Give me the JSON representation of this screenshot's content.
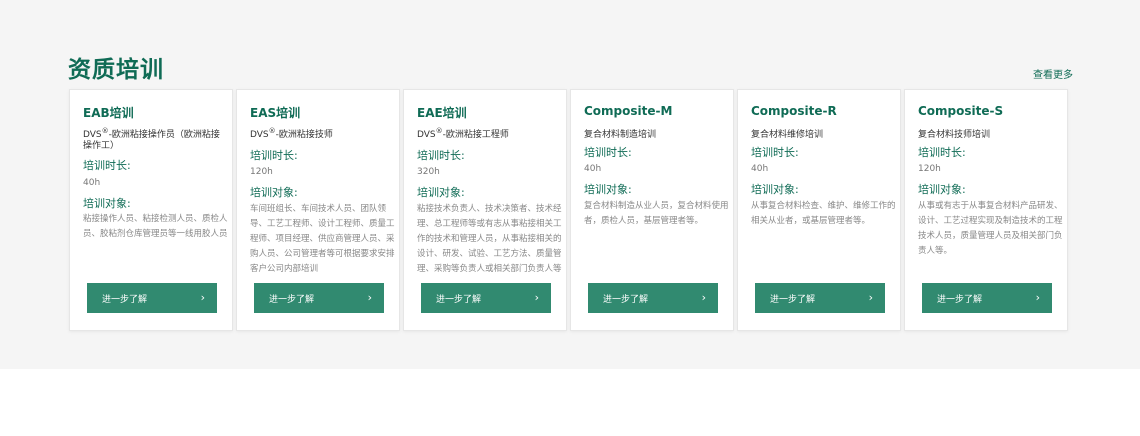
{
  "section": {
    "title": "资质培训",
    "more": "查看更多"
  },
  "labels": {
    "duration": "培训时长:",
    "audience": "培训对象:",
    "button": "进一步了解"
  },
  "cards": [
    {
      "title": "EAB培训",
      "sub_prefix": "DVS",
      "sub_sup": "®",
      "sub_suffix": "-欧洲粘接操作员（欧洲粘接操作工）",
      "hours": "40h",
      "audience": "粘接操作人员、粘接检测人员、质检人员、胶粘剂仓库管理员等一线用胶人员"
    },
    {
      "title": "EAS培训",
      "sub_prefix": "DVS",
      "sub_sup": "®",
      "sub_suffix": "-欧洲粘接技师",
      "hours": "120h",
      "audience": "车间班组长、车间技术人员、团队领导、工艺工程师、设计工程师、质量工程师、项目经理、供应商管理人员、采购人员、公司管理者等可根据要求安排客户公司内部培训"
    },
    {
      "title": "EAE培训",
      "sub_prefix": "DVS",
      "sub_sup": "®",
      "sub_suffix": "-欧洲粘接工程师",
      "hours": "320h",
      "audience": "粘接技术负责人、技术决策者、技术经理、总工程师等或有志从事粘接相关工作的技术和管理人员，从事粘接相关的设计、研发、试验、工艺方法、质量管理、采购等负责人或相关部门负责人等"
    },
    {
      "title": "Composite-M",
      "sub_prefix": "复合材料制造培训",
      "sub_sup": "",
      "sub_suffix": "",
      "hours": "40h",
      "audience": "复合材料制造从业人员，复合材料使用者，质检人员，基层管理者等。"
    },
    {
      "title": "Composite-R",
      "sub_prefix": "复合材料维修培训",
      "sub_sup": "",
      "sub_suffix": "",
      "hours": "40h",
      "audience": "从事复合材料检查、维护、维修工作的相关从业者，或基层管理者等。"
    },
    {
      "title": "Composite-S",
      "sub_prefix": "复合材料技师培训",
      "sub_sup": "",
      "sub_suffix": "",
      "hours": "120h",
      "audience": "从事或有志于从事复合材料产品研发、设计、工艺过程实现及制造技术的工程技术人员，质量管理人员及相关部门负责人等。"
    }
  ]
}
